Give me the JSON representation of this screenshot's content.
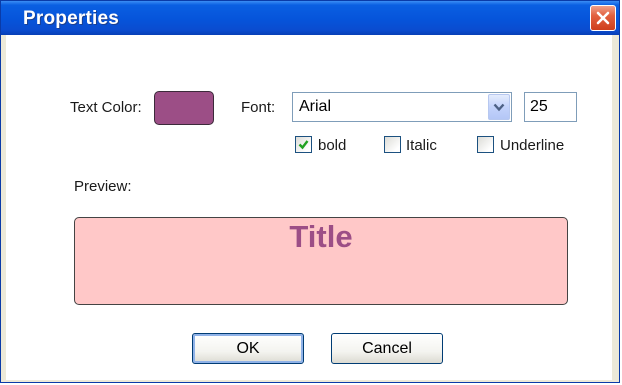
{
  "window": {
    "title": "Properties"
  },
  "text_color": {
    "label": "Text Color:",
    "value": "#9c4e86"
  },
  "font": {
    "label": "Font:",
    "selected": "Arial",
    "size": "25"
  },
  "styles": {
    "bold": {
      "label": "bold",
      "checked": true
    },
    "italic": {
      "label": "Italic",
      "checked": false
    },
    "underline": {
      "label": "Underline",
      "checked": false
    }
  },
  "preview": {
    "label": "Preview:",
    "text": "Title",
    "background": "#ffc8c8"
  },
  "buttons": {
    "ok": "OK",
    "cancel": "Cancel"
  },
  "icons": {
    "close": "close-icon",
    "dropdown": "chevron-down-icon",
    "check": "checkmark-icon"
  },
  "colors": {
    "titlebar": "#0654da",
    "accent": "#9c4e86"
  }
}
